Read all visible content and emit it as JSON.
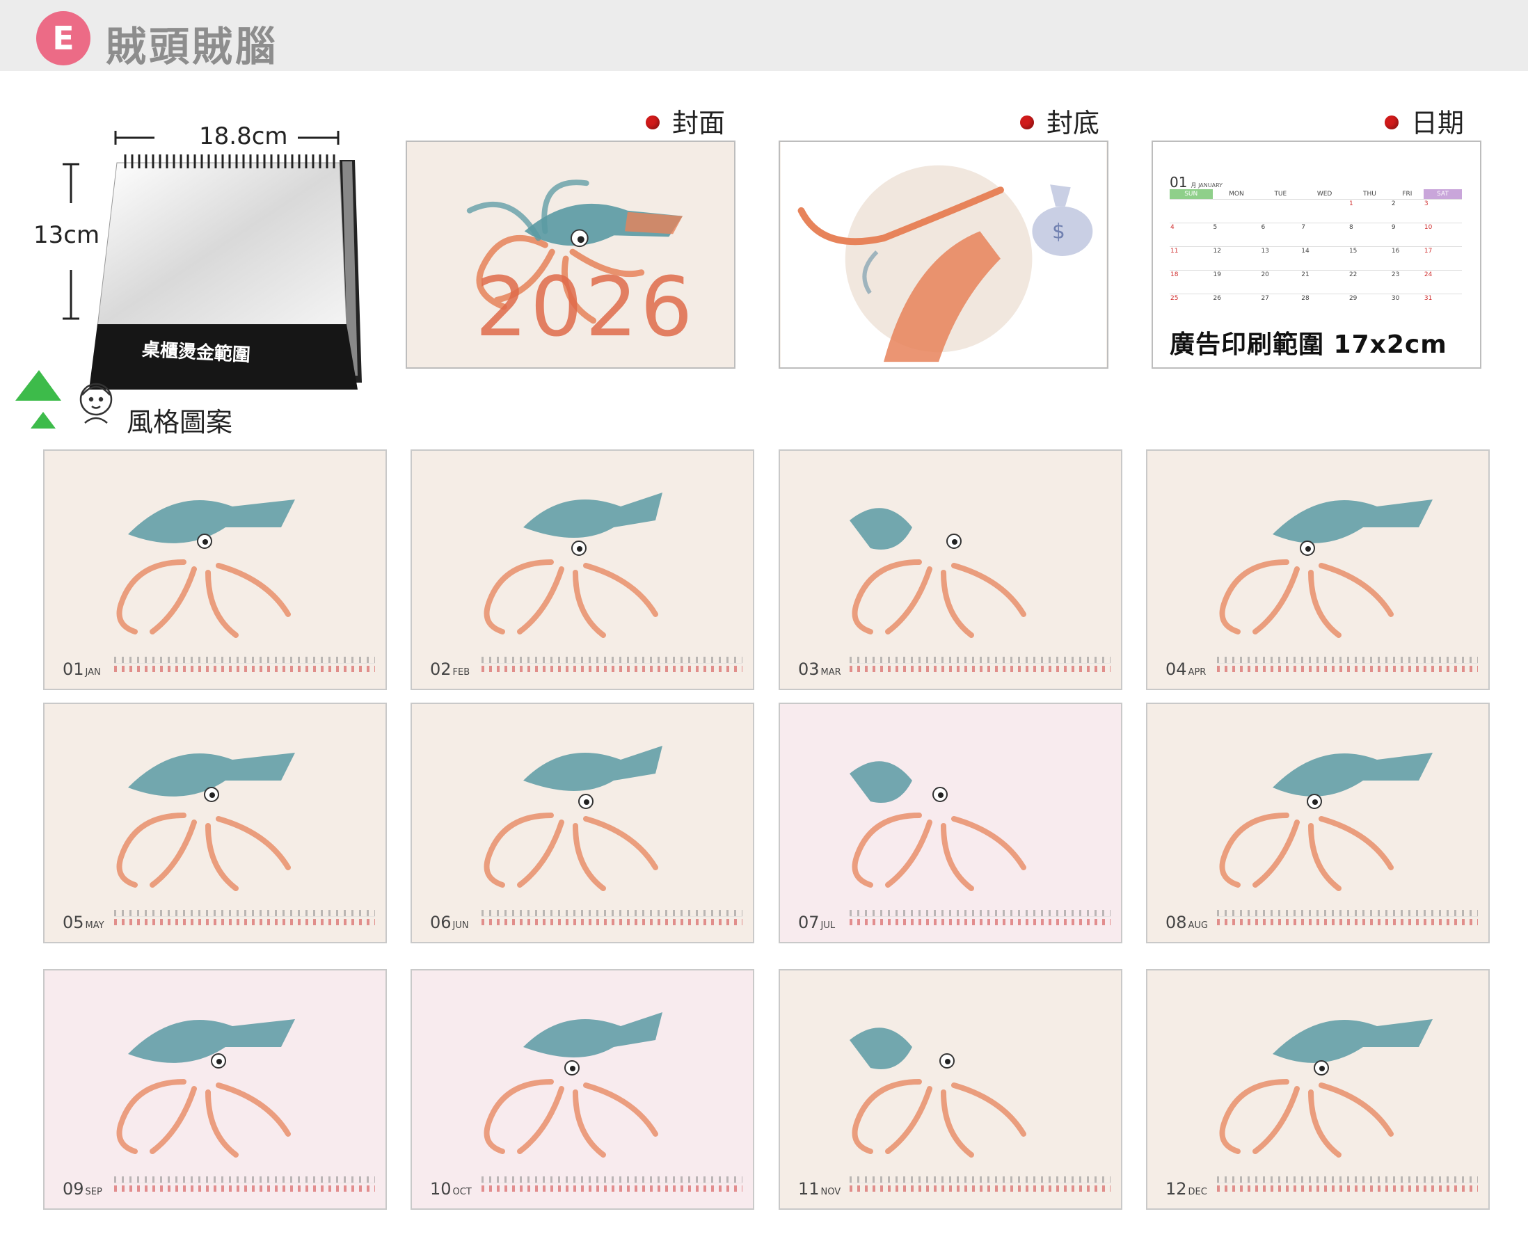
{
  "header": {
    "badge": "E",
    "title": "賊頭賊腦"
  },
  "tent": {
    "width_label": "18.8cm",
    "height_label": "13cm",
    "base_text": "桌櫃燙金範圍"
  },
  "style_label": "風格圖案",
  "sections": {
    "front_cover": "封面",
    "back_cover": "封底",
    "date": "日期"
  },
  "cover_year": "2026",
  "date_page": {
    "month_num": "01",
    "month_name": "月 JANUARY",
    "weekdays": [
      "SUN",
      "MON",
      "TUE",
      "WED",
      "THU",
      "FRI",
      "SAT"
    ],
    "weeks": [
      [
        "",
        "",
        "",
        "",
        "1",
        "2",
        "3"
      ],
      [
        "4",
        "5",
        "6",
        "7",
        "8",
        "9",
        "10"
      ],
      [
        "11",
        "12",
        "13",
        "14",
        "15",
        "16",
        "17"
      ],
      [
        "18",
        "19",
        "20",
        "21",
        "22",
        "23",
        "24"
      ],
      [
        "25",
        "26",
        "27",
        "28",
        "29",
        "30",
        "31"
      ]
    ],
    "ad_text": "廣告印刷範圍 17x2cm"
  },
  "months": [
    {
      "num": "01",
      "abbr": "JAN"
    },
    {
      "num": "02",
      "abbr": "FEB"
    },
    {
      "num": "03",
      "abbr": "MAR"
    },
    {
      "num": "04",
      "abbr": "APR"
    },
    {
      "num": "05",
      "abbr": "MAY"
    },
    {
      "num": "06",
      "abbr": "JUN"
    },
    {
      "num": "07",
      "abbr": "JUL"
    },
    {
      "num": "08",
      "abbr": "AUG"
    },
    {
      "num": "09",
      "abbr": "SEP"
    },
    {
      "num": "10",
      "abbr": "OCT"
    },
    {
      "num": "11",
      "abbr": "NOV"
    },
    {
      "num": "12",
      "abbr": "DEC"
    }
  ],
  "colors": {
    "accent_red": "#d01a1a",
    "badge_pink": "#ec6b86",
    "squid_teal": "#4f8f99",
    "squid_orange": "#e7835a"
  }
}
